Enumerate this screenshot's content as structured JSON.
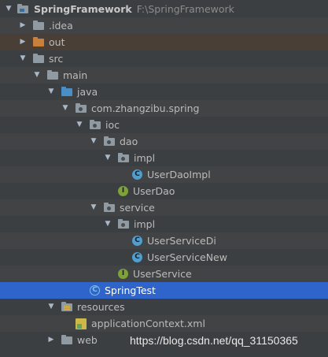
{
  "project": {
    "name": "SpringFramework",
    "path": "F:\\SpringFramework"
  },
  "tree": {
    "idea": ".idea",
    "out": "out",
    "src": "src",
    "main": "main",
    "java": "java",
    "package": "com.zhangzibu.spring",
    "ioc": "ioc",
    "dao": "dao",
    "dao_impl": "impl",
    "user_dao_impl": "UserDaoImpl",
    "user_dao": "UserDao",
    "service": "service",
    "service_impl": "impl",
    "user_service_di": "UserServiceDi",
    "user_service_new": "UserServiceNew",
    "user_service": "UserService",
    "spring_test": "SpringTest",
    "resources": "resources",
    "application_context": "applicationContext.xml",
    "web": "web"
  },
  "icons": {
    "class_icon_letter": "C",
    "interface_icon_letter": "I"
  },
  "colors": {
    "background": "#3c3f41",
    "selection": "#2f65ca",
    "excluded_folder": "#c9803a",
    "source_folder": "#4a8ec8",
    "class_icon": "#4e9fcf",
    "interface_icon": "#7ea13b"
  },
  "watermark": "https://blog.csdn.net/qq_31150365"
}
